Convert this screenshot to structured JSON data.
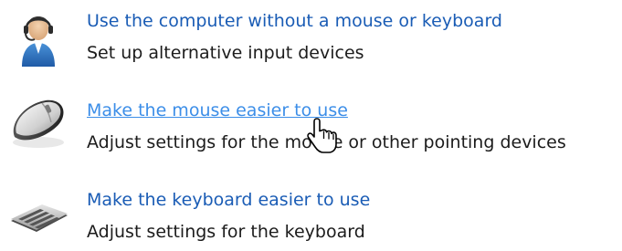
{
  "options": [
    {
      "link": "Use the computer without a mouse or keyboard",
      "description": "Set up alternative input devices",
      "icon": "person-headset-icon"
    },
    {
      "link": "Make the mouse easier to use",
      "description": "Adjust settings for the mouse or other pointing devices",
      "icon": "mouse-icon",
      "state": "hover"
    },
    {
      "link": "Make the keyboard easier to use",
      "description": "Adjust settings for the keyboard",
      "icon": "keyboard-icon"
    }
  ],
  "cursor": "hand-pointer-cursor",
  "colors": {
    "link": "#1a5cb5",
    "link_hover": "#3c8ee8",
    "text": "#1c1c1c"
  }
}
